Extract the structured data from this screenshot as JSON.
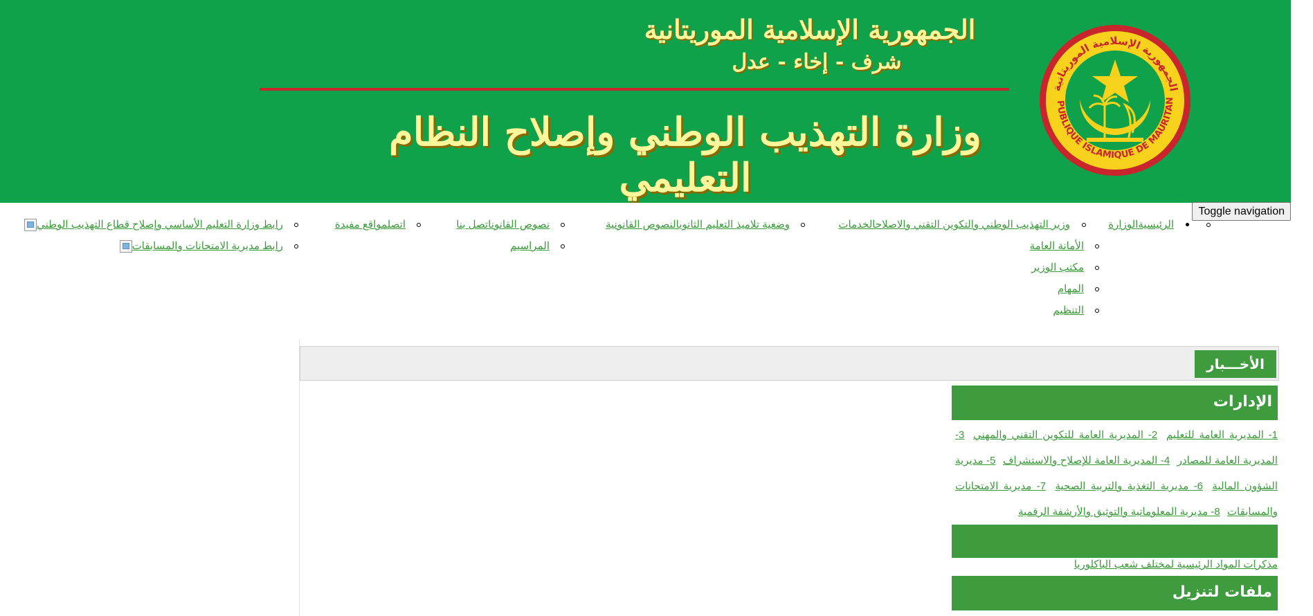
{
  "banner": {
    "republic": "الجمهورية الإسلامية الموريتانية",
    "motto": "شرف - إخاء - عدل",
    "ministry": "وزارة التهذيب الوطني وإصلاح النظام التعليمي",
    "seal_text": "الجمهورية الإسلامية الموريتانية REPUBLIQUE ISLAMIQUE DE MAURITANIE",
    "colors": {
      "green": "#10a14b",
      "gold": "#fbf79a",
      "red": "#c8262c"
    }
  },
  "toggle": {
    "label": "Toggle navigation"
  },
  "nav": {
    "col1": {
      "home": "الرئيسية",
      "ministry": "الوزارة",
      "sub": [
        "الأمانة العامة",
        "مكتب الوزير",
        "المهام",
        "التنظيم"
      ]
    },
    "minister": "وزير التهذيب الوطني والتكوين التقني والاصلاح",
    "services": "الخدمات",
    "status": "وضعية تلاميذ التعليم الثانوي",
    "legal_texts": "النصوص القانونية",
    "laws": "نصوص القانون",
    "decrees": "المراسيم",
    "contact": "اتصل بنا",
    "contact2": "اتصل",
    "useful_sites": "مواقع مفيدة",
    "link_ministry": "رابط وزارة التعليم الأساسي وإصلاح قطاع التهذيب الوطني",
    "link_exams": "رابط مديرية الامتحانات والمسابقات"
  },
  "news": {
    "title": "الأخـــبار"
  },
  "admins": {
    "title": "الإدارات",
    "links": [
      "1- المديرية العامة للتعليم",
      "2- المديرية العامة للتكوين التقني والمهني",
      "3- المديرية العامة للمصادر",
      "4- المديرية العامة للإصلاح والاستشراف",
      "5- مديرية الشؤون المالية",
      "6- مديرية التغذية والتربية الصحية",
      "7- مديرية الامتحانات والمسابقات",
      "8- مديرية المعلوماتية والتوثيق والأرشفة الرقمية"
    ]
  },
  "memos": {
    "title": "",
    "link": "مذكرات المواد الرئيسية لمختلف شعب الباكلوريا"
  },
  "downloads": {
    "title": "ملفات لتنزيل"
  }
}
